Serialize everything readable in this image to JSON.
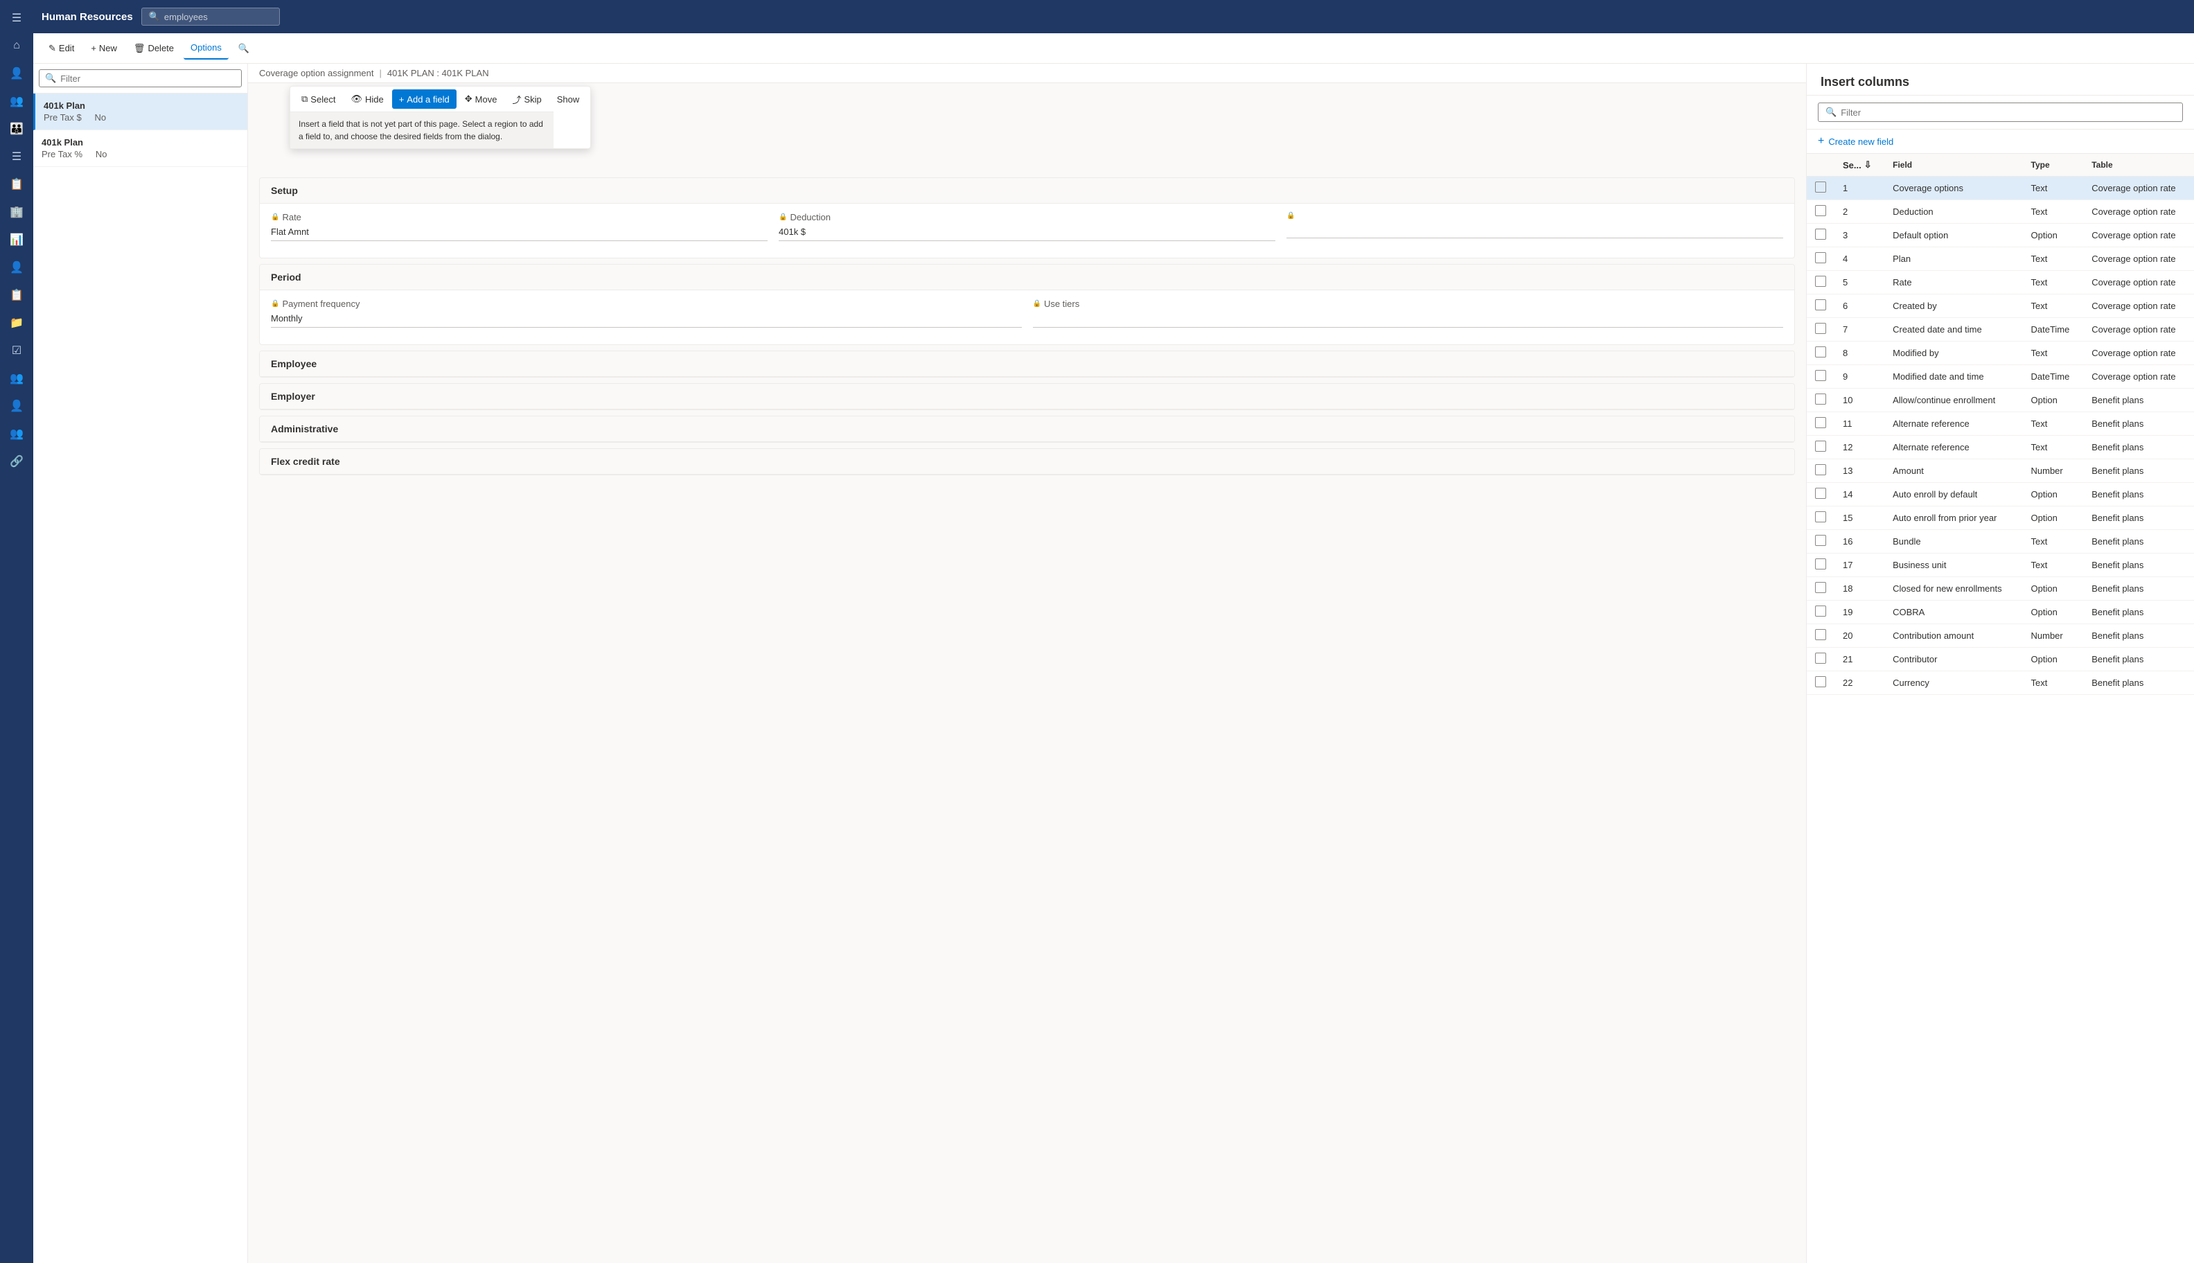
{
  "app": {
    "title": "Human Resources",
    "search_placeholder": "employees"
  },
  "toolbar": {
    "edit_label": "Edit",
    "new_label": "New",
    "delete_label": "Delete",
    "options_label": "Options"
  },
  "list_panel": {
    "filter_placeholder": "Filter",
    "items": [
      {
        "title": "401k Plan",
        "meta1": "Pre Tax $",
        "meta2": "No",
        "selected": true
      },
      {
        "title": "401k Plan",
        "meta1": "Pre Tax %",
        "meta2": "No",
        "selected": false
      }
    ]
  },
  "breadcrumb": {
    "part1": "Coverage option assignment",
    "sep": "|",
    "part2": "401K PLAN : 401K PLAN"
  },
  "floating_toolbar": {
    "select_label": "Select",
    "hide_label": "Hide",
    "add_field_label": "Add a field",
    "move_label": "Move",
    "skip_label": "Skip",
    "show_label": "Show",
    "tooltip": "Insert a field that is not yet part of this page. Select a region to add a field to, and choose the desired fields from the dialog."
  },
  "form": {
    "sections": [
      {
        "title": "Setup",
        "rows": [
          {
            "fields": [
              {
                "label": "Rate",
                "value": "Flat Amnt",
                "locked": true
              },
              {
                "label": "Deduction",
                "value": "401k $",
                "locked": true
              },
              {
                "label": "",
                "value": "",
                "locked": true
              }
            ]
          }
        ]
      },
      {
        "title": "Period",
        "rows": [
          {
            "fields": [
              {
                "label": "Payment frequency",
                "value": "Monthly",
                "locked": true
              },
              {
                "label": "Use tiers",
                "value": "",
                "locked": true
              }
            ]
          }
        ]
      },
      {
        "title": "Employee",
        "rows": []
      },
      {
        "title": "Employer",
        "rows": []
      },
      {
        "title": "Administrative",
        "rows": []
      },
      {
        "title": "Flex credit rate",
        "rows": []
      }
    ]
  },
  "insert_columns": {
    "title": "Insert columns",
    "filter_placeholder": "Filter",
    "create_new_label": "Create new field",
    "col_headers": [
      "Se...",
      "Field",
      "Type",
      "Table"
    ],
    "rows": [
      {
        "field": "Coverage options",
        "type": "Text",
        "table": "Coverage option rate",
        "highlighted": true
      },
      {
        "field": "Deduction",
        "type": "Text",
        "table": "Coverage option rate"
      },
      {
        "field": "Default option",
        "type": "Option",
        "table": "Coverage option rate"
      },
      {
        "field": "Plan",
        "type": "Text",
        "table": "Coverage option rate"
      },
      {
        "field": "Rate",
        "type": "Text",
        "table": "Coverage option rate"
      },
      {
        "field": "Created by",
        "type": "Text",
        "table": "Coverage option rate"
      },
      {
        "field": "Created date and time",
        "type": "DateTime",
        "table": "Coverage option rate"
      },
      {
        "field": "Modified by",
        "type": "Text",
        "table": "Coverage option rate"
      },
      {
        "field": "Modified date and time",
        "type": "DateTime",
        "table": "Coverage option rate"
      },
      {
        "field": "Allow/continue enrollment",
        "type": "Option",
        "table": "Benefit plans"
      },
      {
        "field": "Alternate reference",
        "type": "Text",
        "table": "Benefit plans"
      },
      {
        "field": "Alternate reference",
        "type": "Text",
        "table": "Benefit plans"
      },
      {
        "field": "Amount",
        "type": "Number",
        "table": "Benefit plans"
      },
      {
        "field": "Auto enroll by default",
        "type": "Option",
        "table": "Benefit plans"
      },
      {
        "field": "Auto enroll from prior year",
        "type": "Option",
        "table": "Benefit plans"
      },
      {
        "field": "Bundle",
        "type": "Text",
        "table": "Benefit plans"
      },
      {
        "field": "Business unit",
        "type": "Text",
        "table": "Benefit plans"
      },
      {
        "field": "Closed for new enrollments",
        "type": "Option",
        "table": "Benefit plans"
      },
      {
        "field": "COBRA",
        "type": "Option",
        "table": "Benefit plans"
      },
      {
        "field": "Contribution amount",
        "type": "Number",
        "table": "Benefit plans"
      },
      {
        "field": "Contributor",
        "type": "Option",
        "table": "Benefit plans"
      },
      {
        "field": "Currency",
        "type": "Text",
        "table": "Benefit plans"
      }
    ]
  },
  "nav_icons": [
    "≡",
    "⌂",
    "👤",
    "👥",
    "👨‍👩‍👧",
    "☰",
    "📋",
    "🏢",
    "📊",
    "👤",
    "📋",
    "📁",
    "☑",
    "👥",
    "👤",
    "👥",
    "🔗"
  ]
}
